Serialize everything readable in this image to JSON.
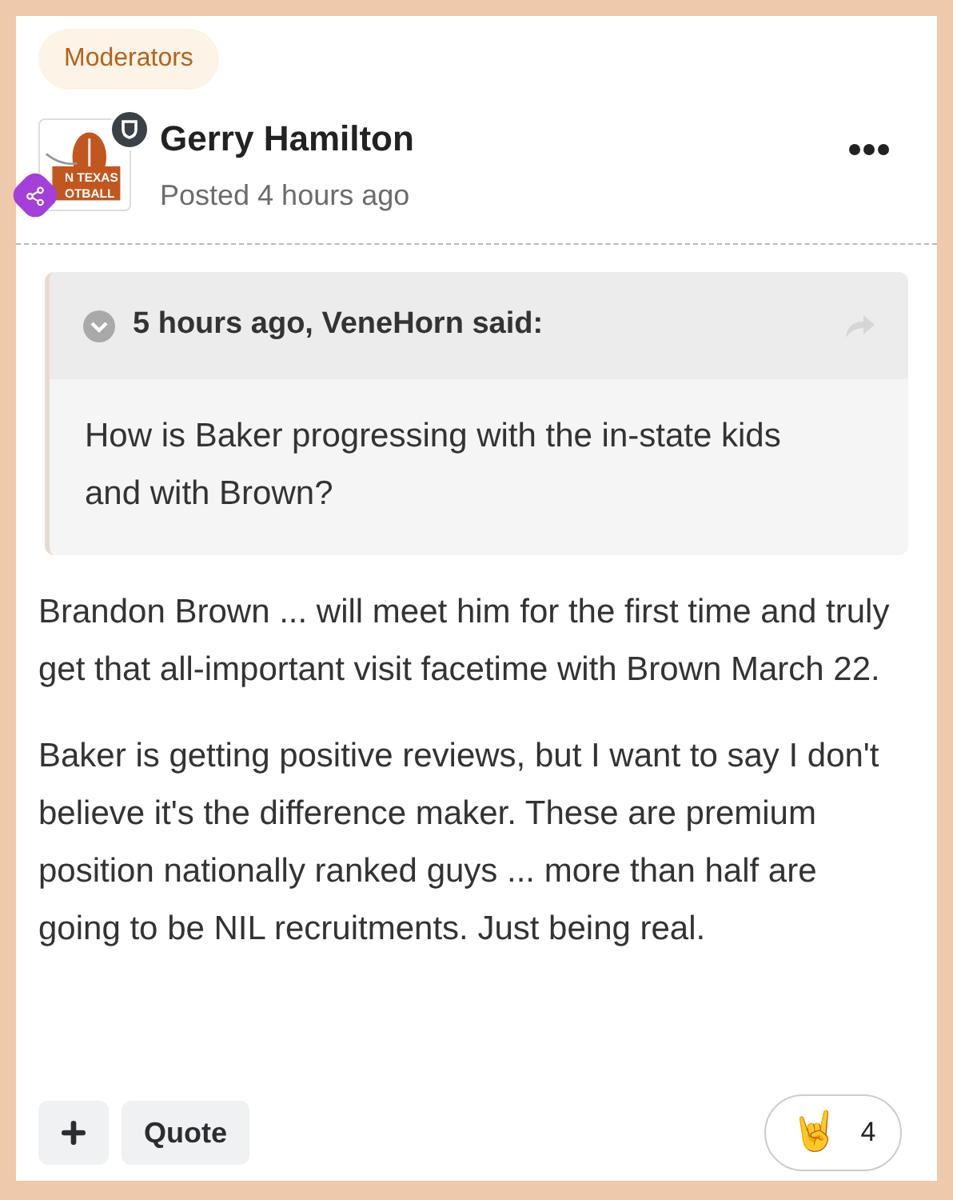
{
  "group_badge": "Moderators",
  "author": {
    "name": "Gerry Hamilton",
    "posted": "Posted 4 hours ago",
    "avatar_text": [
      "N TEXAS",
      "OTBALL"
    ]
  },
  "quote": {
    "header": "5 hours ago, VeneHorn said:",
    "text": "How is Baker progressing with the in-state kids and with Brown?"
  },
  "paragraphs": [
    "Brandon Brown ... will meet him for the first time and truly get that all-important visit facetime with Brown March 22.",
    "Baker is getting positive reviews, but I want to say I don't believe it's the difference maker. These are premium position nationally ranked guys ... more than half are going to be NIL recruitments. Just being real."
  ],
  "actions": {
    "quote_button": "Quote",
    "reaction": {
      "emoji": "🤘",
      "count": "4"
    }
  }
}
